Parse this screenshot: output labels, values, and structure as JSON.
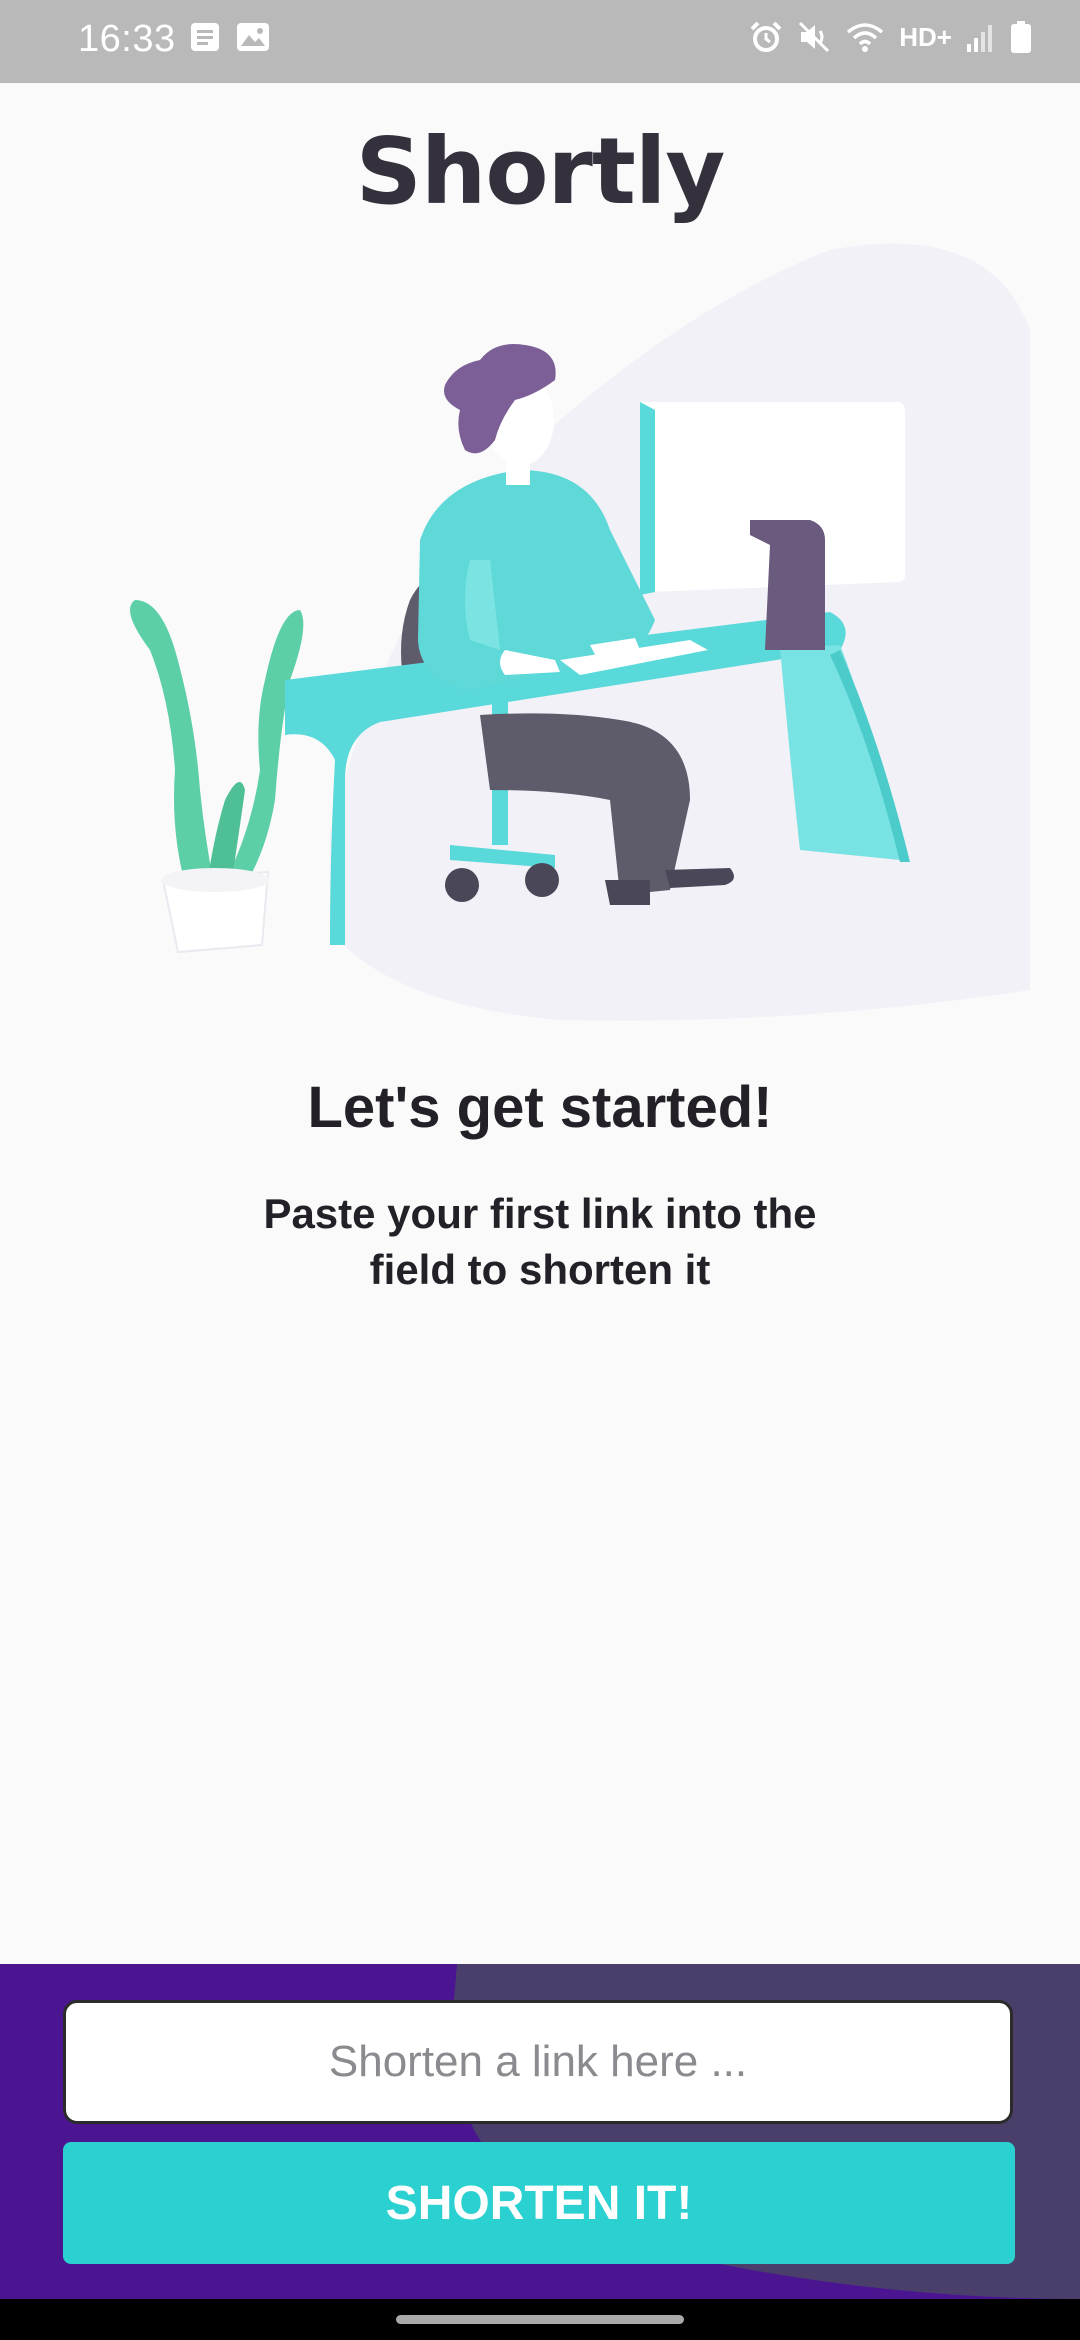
{
  "status_bar": {
    "time": "16:33",
    "network": "HD+",
    "left_icons": [
      "notes-icon",
      "gallery-icon"
    ],
    "right_icons": [
      "alarm-icon",
      "mute-icon",
      "wifi-icon",
      "signal-icon",
      "battery-icon"
    ]
  },
  "app": {
    "title": "Shortly"
  },
  "empty_state": {
    "heading": "Let's get started!",
    "body": "Paste your first link into the field to shorten it"
  },
  "form": {
    "input_placeholder": "Shorten a link here ...",
    "input_value": "",
    "button_label": "SHORTEN IT!"
  },
  "colors": {
    "accent": "#2bd0d0",
    "panel": "#4b1591",
    "title": "#34313d"
  }
}
